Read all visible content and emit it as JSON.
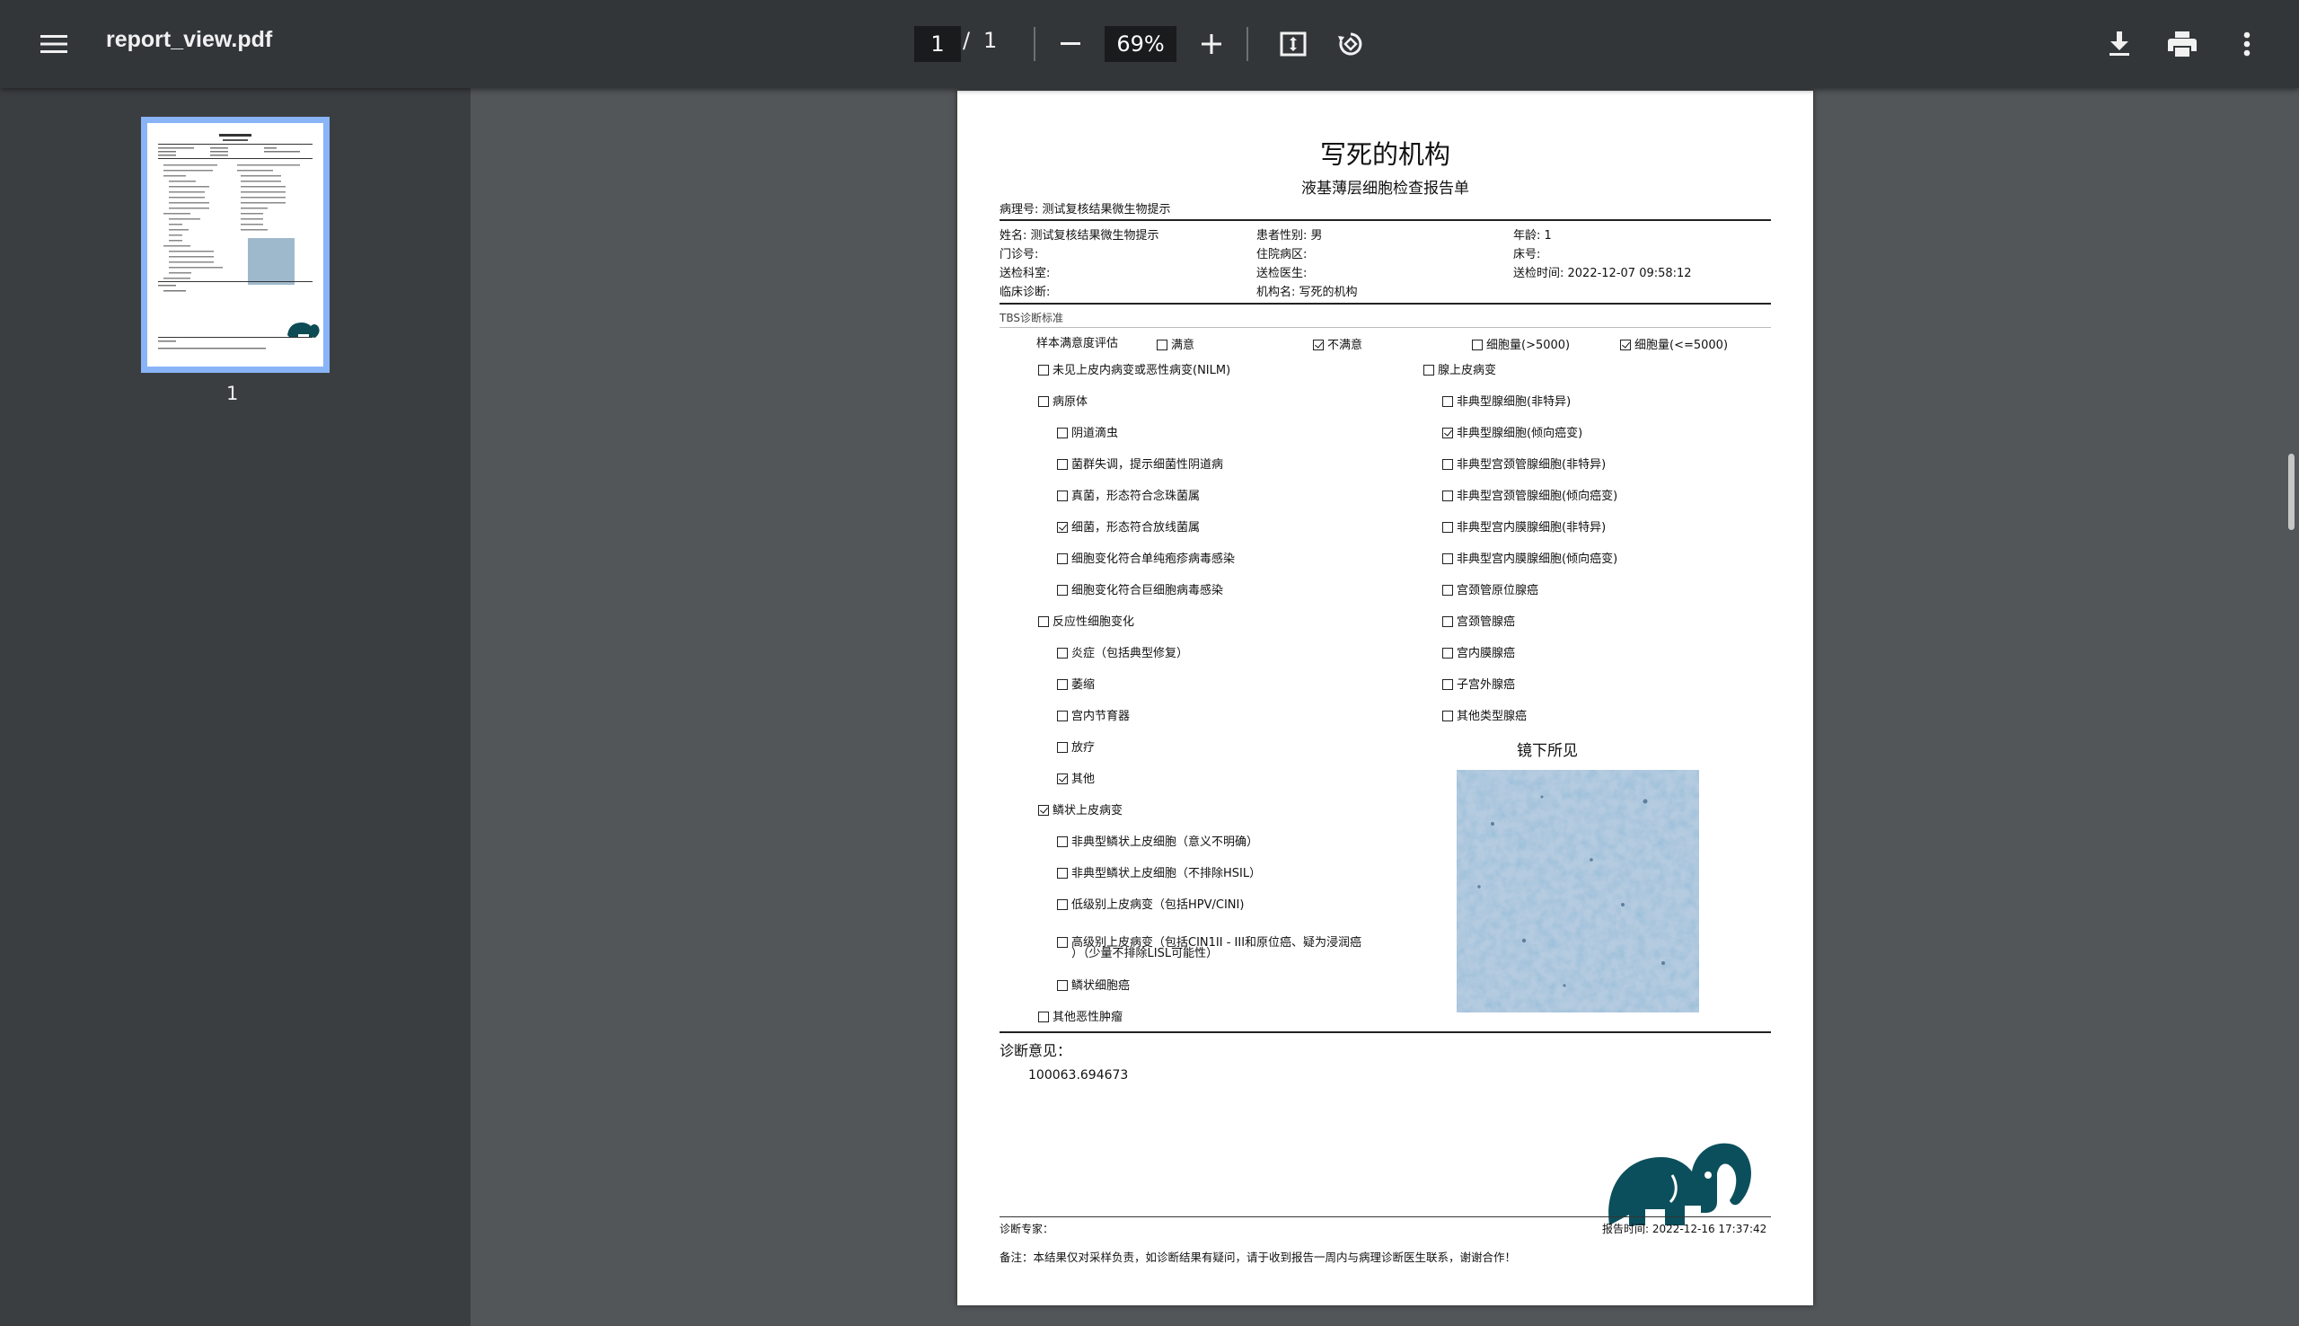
{
  "toolbar": {
    "filename": "report_view.pdf",
    "page_current": "1",
    "page_separator": "/",
    "page_total": "1",
    "zoom": "69%",
    "icons": [
      "menu-icon",
      "minus-icon",
      "plus-icon",
      "fit-page-icon",
      "rotate-icon",
      "download-icon",
      "print-icon",
      "more-vert-icon"
    ]
  },
  "sidebar": {
    "thumbnail_label": "1"
  },
  "report": {
    "institution": "写死的机构",
    "report_type": "液基薄层细胞检查报告单",
    "pathology_no": "病理号: 测试复核结果微生物提示",
    "patient": {
      "name": "姓名: 测试复核结果微生物提示",
      "gender": "患者性别: 男",
      "age": "年龄: 1",
      "outpatient_no": "门诊号:",
      "ward": "住院病区:",
      "bed": "床号:",
      "dept": "送检科室:",
      "doctor": "送检医生:",
      "send_time": "送检时间: 2022-12-07 09:58:12",
      "clinical_diag": "临床诊断:",
      "org": "机构名: 写死的机构"
    },
    "tbs_header": "TBS诊断标准",
    "satisfaction": {
      "label": "样本满意度评估",
      "options": [
        {
          "label": "满意",
          "checked": false
        },
        {
          "label": "不满意",
          "checked": true
        },
        {
          "label": "细胞量(>5000)",
          "checked": false
        },
        {
          "label": "细胞量(<=5000)",
          "checked": true
        }
      ]
    },
    "left_items": [
      {
        "label": "未见上皮内病变或恶性病变(NILM)",
        "checked": false,
        "level": 0
      },
      {
        "label": "病原体",
        "checked": false,
        "level": 0
      },
      {
        "label": "阴道滴虫",
        "checked": false,
        "level": 1
      },
      {
        "label": "菌群失调，提示细菌性阴道病",
        "checked": false,
        "level": 1
      },
      {
        "label": "真菌，形态符合念珠菌属",
        "checked": false,
        "level": 1
      },
      {
        "label": "细菌，形态符合放线菌属",
        "checked": true,
        "level": 1
      },
      {
        "label": "细胞变化符合单纯疱疹病毒感染",
        "checked": false,
        "level": 1
      },
      {
        "label": "细胞变化符合巨细胞病毒感染",
        "checked": false,
        "level": 1
      },
      {
        "label": "反应性细胞变化",
        "checked": false,
        "level": 0
      },
      {
        "label": "炎症（包括典型修复）",
        "checked": false,
        "level": 1
      },
      {
        "label": "萎缩",
        "checked": false,
        "level": 1
      },
      {
        "label": "宫内节育器",
        "checked": false,
        "level": 1
      },
      {
        "label": "放疗",
        "checked": false,
        "level": 1
      },
      {
        "label": "其他",
        "checked": true,
        "level": 1
      },
      {
        "label": "鳞状上皮病变",
        "checked": true,
        "level": 0
      },
      {
        "label": "非典型鳞状上皮细胞（意义不明确）",
        "checked": false,
        "level": 1
      },
      {
        "label": "非典型鳞状上皮细胞（不排除HSIL）",
        "checked": false,
        "level": 1
      },
      {
        "label": "低级别上皮病变（包括HPV/CINI)",
        "checked": false,
        "level": 1
      },
      {
        "label": "高级别上皮病变（包括CIN1II - III和原位癌、疑为浸润癌",
        "label2": "）（少量不排除LISL可能性）",
        "checked": false,
        "level": 1
      },
      {
        "label": "鳞状细胞癌",
        "checked": false,
        "level": 1
      },
      {
        "label": "其他恶性肿瘤",
        "checked": false,
        "level": 0
      }
    ],
    "right_items": [
      {
        "label": "腺上皮病变",
        "checked": false,
        "level": 0
      },
      {
        "label": "非典型腺细胞(非特异)",
        "checked": false,
        "level": 1
      },
      {
        "label": "非典型腺细胞(倾向癌变)",
        "checked": true,
        "level": 1
      },
      {
        "label": "非典型宫颈管腺细胞(非特异)",
        "checked": false,
        "level": 1
      },
      {
        "label": "非典型宫颈管腺细胞(倾向癌变)",
        "checked": false,
        "level": 1
      },
      {
        "label": "非典型宫内膜腺细胞(非特异)",
        "checked": false,
        "level": 1
      },
      {
        "label": "非典型宫内膜腺细胞(倾向癌变)",
        "checked": false,
        "level": 1
      },
      {
        "label": "宫颈管原位腺癌",
        "checked": false,
        "level": 1
      },
      {
        "label": "宫颈管腺癌",
        "checked": false,
        "level": 1
      },
      {
        "label": "宫内膜腺癌",
        "checked": false,
        "level": 1
      },
      {
        "label": "子宫外腺癌",
        "checked": false,
        "level": 1
      },
      {
        "label": "其他类型腺癌",
        "checked": false,
        "level": 1
      }
    ],
    "microscope_label": "镜下所见",
    "diagnosis_label": "诊断意见：",
    "diagnosis_value": "100063.694673",
    "expert_label": "诊断专家：",
    "report_time": "报告时间: 2022-12-16 17:37:42",
    "note": "备注：本结果仅对采样负责，如诊断结果有疑问，请于收到报告一周内与病理诊断医生联系，谢谢合作！"
  }
}
